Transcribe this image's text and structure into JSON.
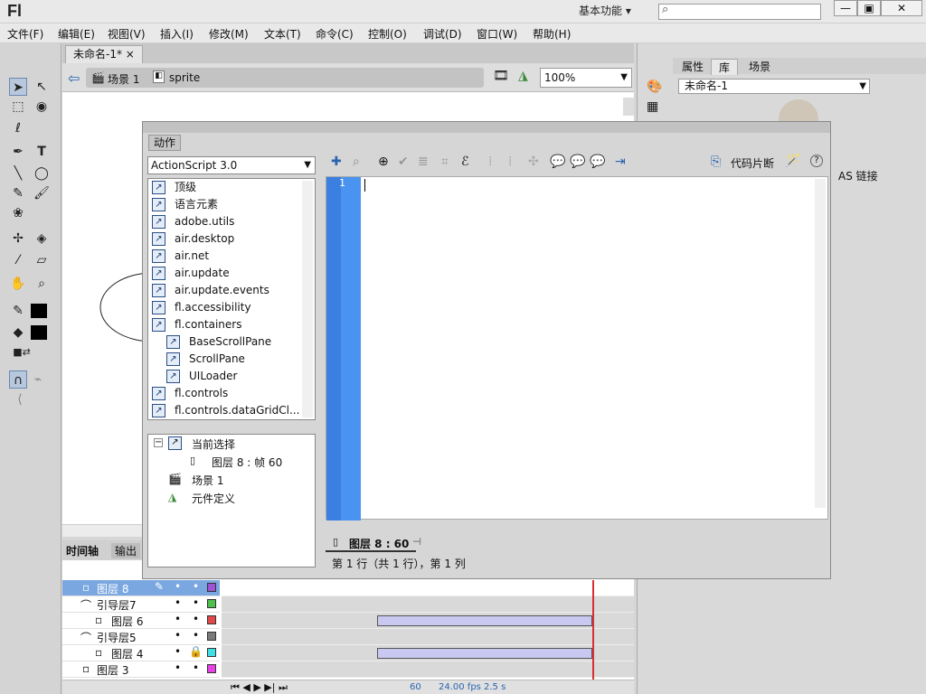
{
  "app": {
    "logo": "Fl",
    "workspace": "基本功能",
    "workspace_arrow": "▾",
    "search_icon": "⌕",
    "win_min": "—",
    "win_max": "▣",
    "win_close": "✕"
  },
  "menu": [
    "文件(F)",
    "编辑(E)",
    "视图(V)",
    "插入(I)",
    "修改(M)",
    "文本(T)",
    "命令(C)",
    "控制(O)",
    "调试(D)",
    "窗口(W)",
    "帮助(H)"
  ],
  "document": {
    "tab": "未命名-1*",
    "tab_close": "×",
    "crumbs": [
      "场景 1",
      "sprite"
    ],
    "zoom": "100%"
  },
  "timeline": {
    "tabs": [
      "时间轴",
      "输出"
    ],
    "layers": [
      {
        "name": "图层 8",
        "selected": true,
        "color": "#9e52d4"
      },
      {
        "name": "引导层7",
        "selected": false,
        "color": "#4ec04e"
      },
      {
        "name": "图层 6",
        "selected": false,
        "color": "#e24848"
      },
      {
        "name": "引导层5",
        "selected": false,
        "color": "#7a7a7a"
      },
      {
        "name": "图层 4",
        "selected": false,
        "color": "#40e0e6"
      },
      {
        "name": "图层 3",
        "selected": false,
        "color": "#e640e6"
      }
    ],
    "frame": "60",
    "fps": "24.00 fps",
    "time": "2.5 s"
  },
  "right": {
    "tabs": [
      "属性",
      "库",
      "场景"
    ],
    "library": "未命名-1",
    "as_link": "AS 链接"
  },
  "actions": {
    "title": "动作",
    "version": "ActionScript 3.0",
    "tree": [
      {
        "label": "顶级",
        "indent": 0
      },
      {
        "label": "语言元素",
        "indent": 0
      },
      {
        "label": "adobe.utils",
        "indent": 0
      },
      {
        "label": "air.desktop",
        "indent": 0
      },
      {
        "label": "air.net",
        "indent": 0
      },
      {
        "label": "air.update",
        "indent": 0
      },
      {
        "label": "air.update.events",
        "indent": 0
      },
      {
        "label": "fl.accessibility",
        "indent": 0
      },
      {
        "label": "fl.containers",
        "indent": 0
      },
      {
        "label": "BaseScrollPane",
        "indent": 1
      },
      {
        "label": "ScrollPane",
        "indent": 1
      },
      {
        "label": "UILoader",
        "indent": 1
      },
      {
        "label": "fl.controls",
        "indent": 0
      },
      {
        "label": "fl.controls.dataGridCl...",
        "indent": 0
      }
    ],
    "nav": {
      "current": "当前选择",
      "current_item": "图层 8 : 帧 60",
      "scene": "场景 1",
      "symbol": "元件定义"
    },
    "code_snippets": "代码片断",
    "line_number": "1",
    "script_tab": "图层 8 : 60",
    "status": "第 1 行（共 1 行），第 1 列"
  }
}
